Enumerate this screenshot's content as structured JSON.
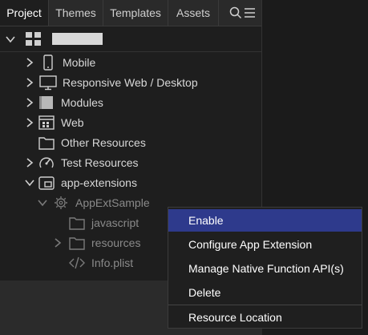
{
  "tabs": [
    "Project",
    "Themes",
    "Templates",
    "Assets"
  ],
  "toolbar": {
    "search_icon": "search-icon",
    "menu_icon": "list-menu-icon"
  },
  "project": {
    "name": ""
  },
  "tree": [
    {
      "label": "Mobile",
      "icon": "mobile-icon",
      "expanded": false
    },
    {
      "label": "Responsive Web / Desktop",
      "icon": "desktop-icon",
      "expanded": false
    },
    {
      "label": "Modules",
      "icon": "module-icon",
      "expanded": false
    },
    {
      "label": "Web",
      "icon": "web-icon",
      "expanded": false
    },
    {
      "label": "Other Resources",
      "icon": "folder-icon"
    },
    {
      "label": "Test Resources",
      "icon": "gauge-icon",
      "expanded": false
    },
    {
      "label": "app-extensions",
      "icon": "extension-icon",
      "expanded": true
    },
    {
      "label": "AppExtSample",
      "icon": "gear-icon",
      "expanded": true
    },
    {
      "label": "javascript",
      "icon": "folder-icon"
    },
    {
      "label": "resources",
      "icon": "folder-icon",
      "expanded": false
    },
    {
      "label": "Info.plist",
      "icon": "code-icon"
    }
  ],
  "context_menu": {
    "items": [
      "Enable",
      "Configure App Extension",
      "Manage Native Function API(s)",
      "Delete",
      "Resource Location"
    ],
    "highlighted": "Enable"
  },
  "colors": {
    "highlight": "#2e3a8c",
    "panel": "#1e1e1e"
  }
}
